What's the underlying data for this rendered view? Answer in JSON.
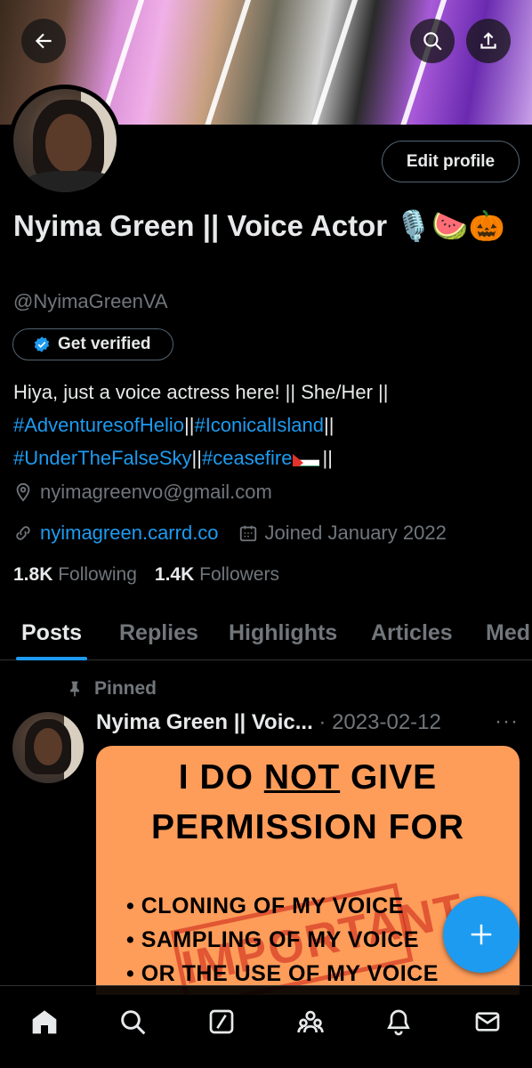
{
  "header": {
    "back_icon": "arrow-left-icon",
    "search_icon": "search-icon",
    "share_icon": "share-icon"
  },
  "profile": {
    "edit_label": "Edit profile",
    "name": "Nyima Green || Voice Actor 🎙️🍉🎃",
    "handle": "@NyimaGreenVA",
    "verified_label": "Get verified",
    "bio": {
      "line1": "Hiya, just a voice actress here! || She/Her ||",
      "tag1": "#AdventuresofHelio",
      "sep1": "||",
      "tag2": "#IconicalIsland",
      "sep2": "||",
      "tag3": "#UnderTheFalseSky",
      "sep3": "||",
      "tag4": "#ceasefire",
      "end": "||"
    },
    "email": "nyimagreenvo@gmail.com",
    "website": "nyimagreen.carrd.co",
    "joined": "Joined January 2022",
    "following_count": "1.8K",
    "following_label": "Following",
    "followers_count": "1.4K",
    "followers_label": "Followers"
  },
  "tabs": [
    {
      "label": "Posts",
      "active": true
    },
    {
      "label": "Replies",
      "active": false
    },
    {
      "label": "Highlights",
      "active": false
    },
    {
      "label": "Articles",
      "active": false
    },
    {
      "label": "Med",
      "active": false
    }
  ],
  "post": {
    "pinned_label": "Pinned",
    "author": "Nyima Green || Voic...",
    "date": "· 2023-02-12",
    "more": "···",
    "image_lines": {
      "h1": "I DO NOT GIVE",
      "h1_pre": "I DO ",
      "h1_emph": "NOT",
      "h1_post": " GIVE",
      "h2": "PERMISSION FOR",
      "b1": "• CLONING OF MY VOICE",
      "b2": "• SAMPLING OF MY VOICE",
      "b3": "• OR THE USE OF MY VOICE",
      "stamp": "IMPORTANT"
    }
  },
  "colors": {
    "accent": "#1d9bf0",
    "muted": "#71767b",
    "text": "#e7e9ea",
    "media_bg": "#fe9c5a"
  },
  "nav": [
    "home-icon",
    "search-icon",
    "grok-icon",
    "communities-icon",
    "notifications-icon",
    "messages-icon"
  ]
}
